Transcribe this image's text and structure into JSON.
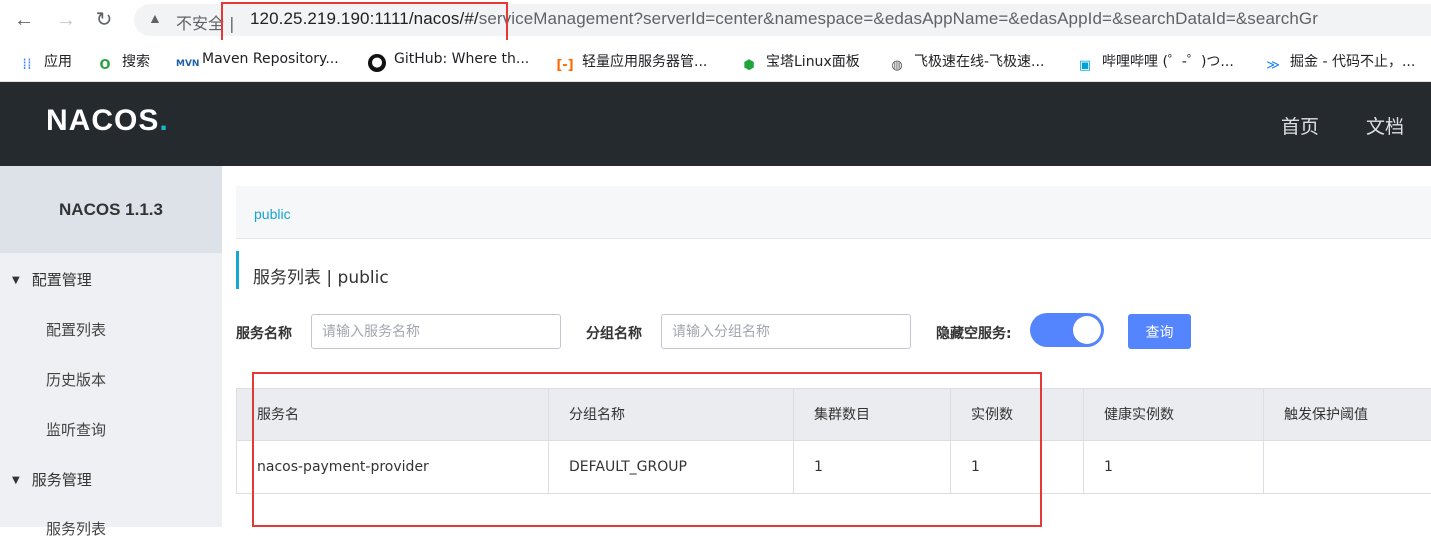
{
  "browser": {
    "insecure_label": "不安全",
    "url_host": "120.25.219.190:1111/nacos/#/",
    "url_rest": "serviceManagement?serverId=center&namespace=&edasAppName=&edasAppId=&searchDataId=&searchGr"
  },
  "bookmarks": [
    {
      "label": "应用",
      "icon": "apps-grid-icon"
    },
    {
      "label": "搜索",
      "icon": "search-o-icon"
    },
    {
      "label": "Maven Repository...",
      "icon": "maven-icon"
    },
    {
      "label": "GitHub: Where th...",
      "icon": "github-icon"
    },
    {
      "label": "轻量应用服务器管...",
      "icon": "aliyun-icon"
    },
    {
      "label": "宝塔Linux面板",
      "icon": "bt-icon"
    },
    {
      "label": "飞极速在线-飞极速...",
      "icon": "globe-icon"
    },
    {
      "label": "哔哩哔哩 (゜-゜)つ...",
      "icon": "bilibili-icon"
    },
    {
      "label": "掘金 - 代码不止，...",
      "icon": "juejin-icon"
    }
  ],
  "header": {
    "logo": "NACOS",
    "logo_dot": ".",
    "nav": [
      "首页",
      "文档"
    ]
  },
  "sidebar": {
    "title": "NACOS 1.1.3",
    "groups": [
      {
        "label": "配置管理",
        "items": [
          "配置列表",
          "历史版本",
          "监听查询"
        ]
      },
      {
        "label": "服务管理",
        "items": [
          "服务列表"
        ]
      }
    ]
  },
  "main": {
    "namespace": "public",
    "page_title": "服务列表  |  public",
    "filters": {
      "service_name_label": "服务名称",
      "service_name_placeholder": "请输入服务名称",
      "group_name_label": "分组名称",
      "group_name_placeholder": "请输入分组名称",
      "hide_empty_label": "隐藏空服务:",
      "hide_empty_on": true,
      "query_label": "查询"
    },
    "table": {
      "headers": [
        "服务名",
        "分组名称",
        "集群数目",
        "实例数",
        "健康实例数",
        "触发保护阈值"
      ],
      "rows": [
        [
          "nacos-payment-provider",
          "DEFAULT_GROUP",
          "1",
          "1",
          "1",
          ""
        ]
      ]
    }
  },
  "colors": {
    "accent": "#5584ff",
    "link": "#17a5d1",
    "topbar": "#252a2f",
    "highlight": "#e53935"
  }
}
